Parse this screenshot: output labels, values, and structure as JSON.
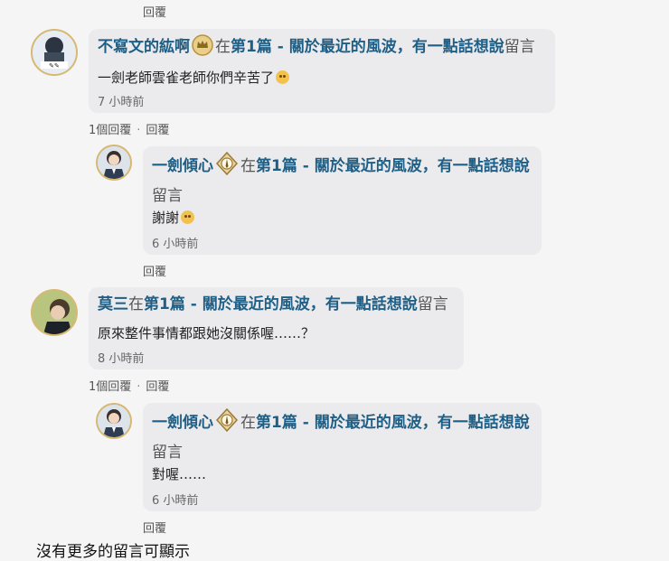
{
  "reply_label": "回覆",
  "count_reply_label": "1個回覆",
  "dot": "·",
  "in_label": "在",
  "comment_label": "留言",
  "post_title": "第1篇 - 關於最近的風波，有一點話想說",
  "comments": [
    {
      "user": "不寫文的紘啊",
      "badge_icon": "crown-badge",
      "text": "一劍老師雲雀老師你們辛苦了",
      "time": "7 小時前",
      "reply": {
        "user": "一劍傾心",
        "badge_icon": "quill-badge",
        "text": "謝謝",
        "time": "6 小時前"
      }
    },
    {
      "user": "莫三",
      "text": "原來整件事情都跟她沒關係喔……？",
      "time": "8 小時前",
      "reply": {
        "user": "一劍傾心",
        "badge_icon": "quill-badge",
        "text": "對喔……",
        "time": "6 小時前"
      }
    }
  ],
  "end_message": "沒有更多的留言可顯示"
}
